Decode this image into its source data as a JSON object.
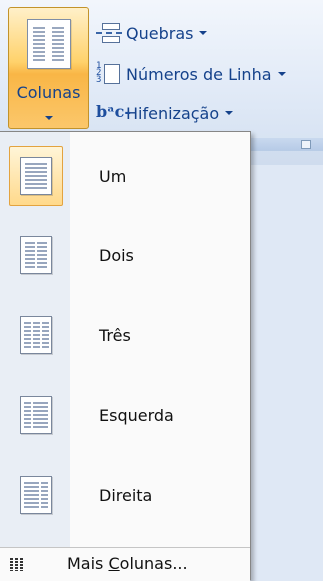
{
  "ribbon": {
    "colunas_label": "Colunas",
    "quebras_label": "Quebras",
    "numeros_label": "Números de Linha",
    "hifenizacao_label": "Hifenização",
    "hifenizacao_icon_text": "bᵃc-"
  },
  "menu": {
    "items": [
      {
        "label": "Um",
        "columns": "one"
      },
      {
        "label": "Dois",
        "columns": "two"
      },
      {
        "label": "Três",
        "columns": "three"
      },
      {
        "label": "Esquerda",
        "columns": "left"
      },
      {
        "label": "Direita",
        "columns": "right"
      }
    ],
    "more_prefix": "Mais ",
    "more_underlined": "C",
    "more_suffix": "olunas...",
    "selected_index": 0
  },
  "colors": {
    "ribbon_text": "#15428b",
    "highlight_border": "#e3a33f",
    "highlight_fill": "#ffd98b"
  }
}
